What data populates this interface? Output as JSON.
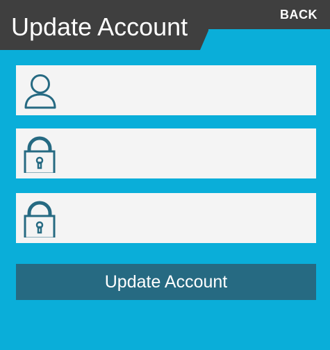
{
  "header": {
    "title": "Update Account",
    "back_label": "BACK"
  },
  "form": {
    "fields": [
      {
        "icon": "user-icon",
        "value": "",
        "placeholder": ""
      },
      {
        "icon": "lock-icon",
        "value": "",
        "placeholder": ""
      },
      {
        "icon": "lock-icon",
        "value": "",
        "placeholder": ""
      }
    ],
    "submit_label": "Update Account"
  },
  "colors": {
    "background": "#0aaed9",
    "header": "#3f3f3f",
    "field_background": "#f4f4f4",
    "icon": "#266a82",
    "button": "#266a82",
    "text_light": "#ffffff"
  }
}
